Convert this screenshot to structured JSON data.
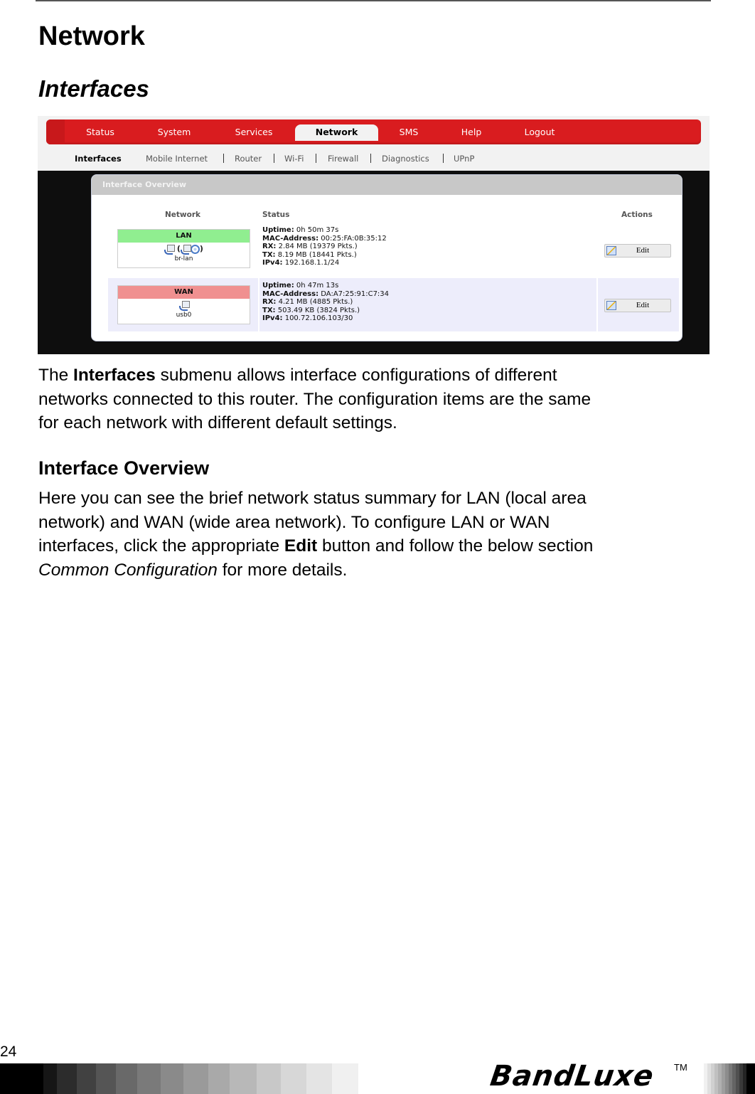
{
  "document": {
    "heading": "Network",
    "subheading": "Interfaces",
    "para1": {
      "pre": "The ",
      "bold": "Interfaces",
      "post_lines": [
        " submenu allows interface configurations of different",
        "networks connected to this router. The configuration items are the same",
        "for each network with different default settings."
      ]
    },
    "section_heading": "Interface Overview",
    "para2": {
      "lines": [
        "Here you can see the brief network status summary for LAN (local area",
        "network) and WAN (wide area network). To configure LAN or WAN"
      ],
      "line3_pre": "interfaces, click the appropriate ",
      "line3_bold": "Edit",
      "line3_post": " button and follow the below section",
      "line4_italic": "Common Configuration",
      "line4_post": " for more details."
    },
    "page_number": "24",
    "brand": "BandLuxe",
    "trademark": "TM"
  },
  "screenshot": {
    "menu": [
      "Status",
      "System",
      "Services",
      "Network",
      "SMS",
      "Help",
      "Logout"
    ],
    "active_menu": "Network",
    "submenu": [
      "Interfaces",
      "Mobile Internet",
      "Router",
      "Wi-Fi",
      "Firewall",
      "Diagnostics",
      "UPnP"
    ],
    "active_submenu": "Interfaces",
    "panel_title": "Interface Overview",
    "columns": {
      "network": "Network",
      "status": "Status",
      "actions": "Actions"
    },
    "interfaces": [
      {
        "name": "LAN",
        "color": "#90ee90",
        "icons": [
          "ethernet-port-icon",
          "ethernet-port-icon",
          "wifi-icon"
        ],
        "device": "br-lan",
        "uptime_label": "Uptime:",
        "uptime": " 0h 50m 37s",
        "mac_label": "MAC-Address:",
        "mac": " 00:25:FA:0B:35:12",
        "rx_label": "RX:",
        "rx": " 2.84 MB (19379 Pkts.)",
        "tx_label": "TX:",
        "tx": " 8.19 MB (18441 Pkts.)",
        "ipv4_label": "IPv4:",
        "ipv4": " 192.168.1.1/24",
        "action": "Edit"
      },
      {
        "name": "WAN",
        "color": "#f09090",
        "icons": [
          "ethernet-port-icon"
        ],
        "device": "usb0",
        "uptime_label": "Uptime:",
        "uptime": " 0h 47m 13s",
        "mac_label": "MAC-Address:",
        "mac": " DA:A7:25:91:C7:34",
        "rx_label": "RX:",
        "rx": " 4.21 MB (4885 Pkts.)",
        "tx_label": "TX:",
        "tx": " 503.49 KB (3824 Pkts.)",
        "ipv4_label": "IPv4:",
        "ipv4": " 100.72.106.103/30",
        "action": "Edit"
      }
    ]
  },
  "colors": {
    "menu_red": "#d91c1f",
    "lan_green": "#90ee90",
    "wan_red": "#f09090",
    "row_alt": "#ededfb"
  }
}
